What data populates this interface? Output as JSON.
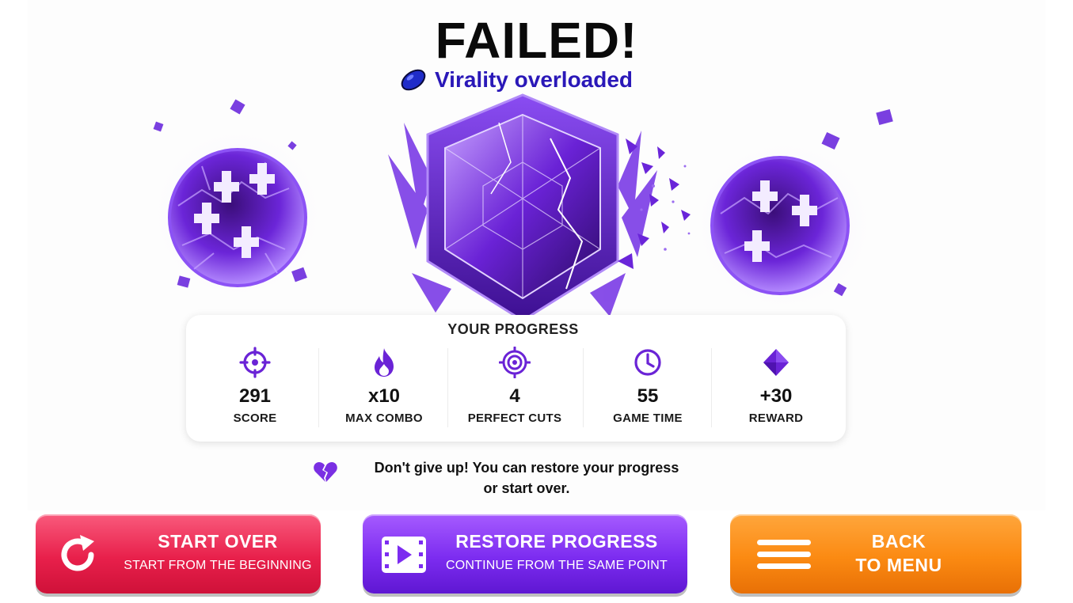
{
  "header": {
    "title": "FAILED!",
    "subtitle": "Virality overloaded"
  },
  "progress": {
    "title": "YOUR PROGRESS",
    "stats": [
      {
        "icon": "crosshair-icon",
        "value": "291",
        "label": "SCORE"
      },
      {
        "icon": "flame-icon",
        "value": "x10",
        "label": "MAX COMBO"
      },
      {
        "icon": "target-icon",
        "value": "4",
        "label": "PERFECT CUTS"
      },
      {
        "icon": "clock-icon",
        "value": "55",
        "label": "GAME TIME"
      },
      {
        "icon": "diamond-icon",
        "value": "+30",
        "label": "REWARD"
      }
    ]
  },
  "message": {
    "line1": "Don't give up! You can restore your progress",
    "line2": "or start over."
  },
  "buttons": {
    "start_over": {
      "title": "START OVER",
      "subtitle": "START FROM THE BEGINNING",
      "icon": "restart-icon"
    },
    "restore": {
      "title": "RESTORE PROGRESS",
      "subtitle": "CONTINUE FROM THE SAME POINT",
      "icon": "video-play-icon"
    },
    "menu": {
      "title_line1": "BACK",
      "title_line2": "TO MENU",
      "icon": "hamburger-menu-icon"
    }
  },
  "colors": {
    "accent_purple": "#7c2cf0",
    "subtitle_blue": "#2a18b8",
    "start_red": "#e8204b",
    "menu_orange": "#fb8a12"
  }
}
